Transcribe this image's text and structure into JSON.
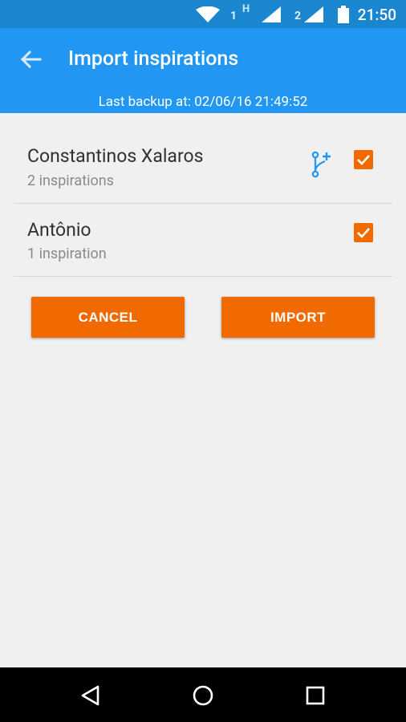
{
  "status_bar": {
    "time": "21:50",
    "sim1_label": "1",
    "sim1_network": "H",
    "sim2_label": "2",
    "icons": [
      "wifi-icon",
      "signal-icon",
      "signal-icon",
      "battery-icon"
    ]
  },
  "app_bar": {
    "title": "Import inspirations",
    "back_icon": "arrow-left-icon"
  },
  "backup_info": "Last backup at: 02/06/16 21:49:52",
  "list": {
    "items": [
      {
        "name": "Constantinos Xalaros",
        "count": "2 inspirations",
        "checked": true,
        "has_merge_icon": true
      },
      {
        "name": "Antônio",
        "count": "1 inspiration",
        "checked": true,
        "has_merge_icon": false
      }
    ]
  },
  "buttons": {
    "cancel_label": "CANCEL",
    "import_label": "IMPORT"
  },
  "colors": {
    "primary": "#2196f3",
    "primary_dark": "#1a86d0",
    "accent": "#f06a00",
    "background": "#f0f0f0"
  },
  "nav_bar": {
    "icons": [
      "back-triangle-icon",
      "home-circle-icon",
      "recents-square-icon"
    ]
  }
}
